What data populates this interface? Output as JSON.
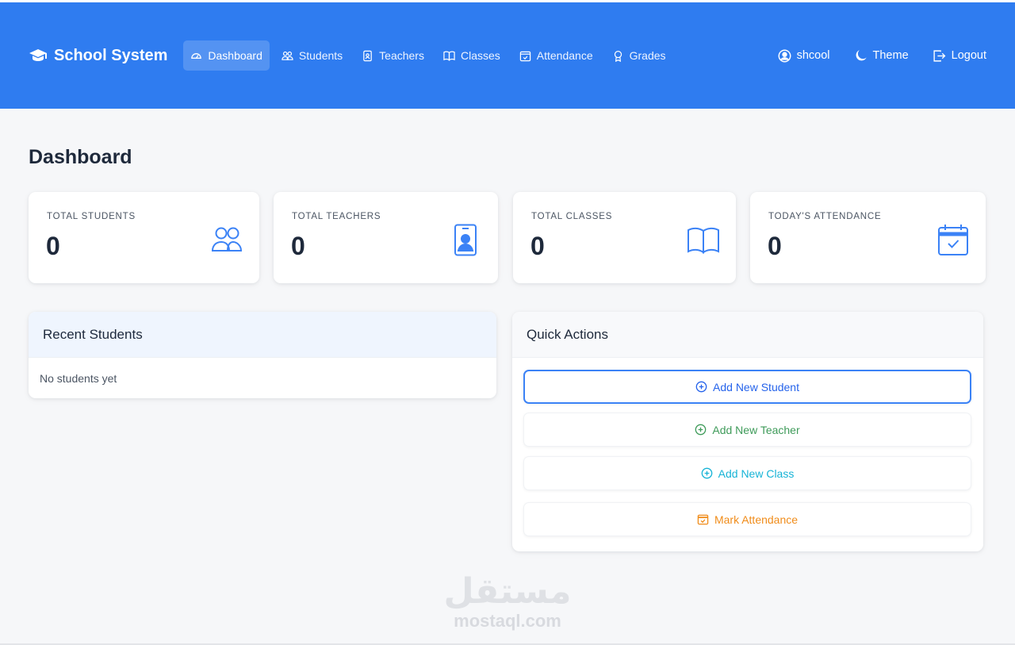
{
  "brand": {
    "name": "School System",
    "icon": "graduation-cap-icon"
  },
  "nav": {
    "items": [
      {
        "label": "Dashboard",
        "icon": "speedometer-icon",
        "active": true
      },
      {
        "label": "Students",
        "icon": "people-icon",
        "active": false
      },
      {
        "label": "Teachers",
        "icon": "badge-icon",
        "active": false
      },
      {
        "label": "Classes",
        "icon": "book-icon",
        "active": false
      },
      {
        "label": "Attendance",
        "icon": "calendar-check-icon",
        "active": false
      },
      {
        "label": "Grades",
        "icon": "award-icon",
        "active": false
      }
    ],
    "user": {
      "label": "shcool",
      "icon": "user-circle-icon"
    },
    "theme": {
      "label": "Theme",
      "icon": "moon-icon"
    },
    "logout": {
      "label": "Logout",
      "icon": "logout-icon"
    }
  },
  "page": {
    "title": "Dashboard"
  },
  "stats": [
    {
      "label": "TOTAL STUDENTS",
      "value": "0",
      "icon": "people-icon"
    },
    {
      "label": "TOTAL TEACHERS",
      "value": "0",
      "icon": "badge-icon"
    },
    {
      "label": "TOTAL CLASSES",
      "value": "0",
      "icon": "book-icon"
    },
    {
      "label": "TODAY'S ATTENDANCE",
      "value": "0",
      "icon": "calendar-check-icon"
    }
  ],
  "recent_students": {
    "title": "Recent Students",
    "empty_text": "No students yet"
  },
  "quick_actions": {
    "title": "Quick Actions",
    "buttons": [
      {
        "label": "Add New Student",
        "icon": "plus-circle-icon",
        "color": "#2563eb"
      },
      {
        "label": "Add New Teacher",
        "icon": "plus-circle-icon",
        "color": "#3f9b5a"
      },
      {
        "label": "Add New Class",
        "icon": "plus-circle-icon",
        "color": "#16b3d6"
      },
      {
        "label": "Mark Attendance",
        "icon": "calendar-check-icon",
        "color": "#f08c1a"
      }
    ]
  },
  "watermark": {
    "arabic": "مستقل",
    "latin": "mostaql.com"
  },
  "colors": {
    "primary": "#2f7cf0",
    "background": "#f6f7f9",
    "accent_blue": "#3b82f6"
  }
}
